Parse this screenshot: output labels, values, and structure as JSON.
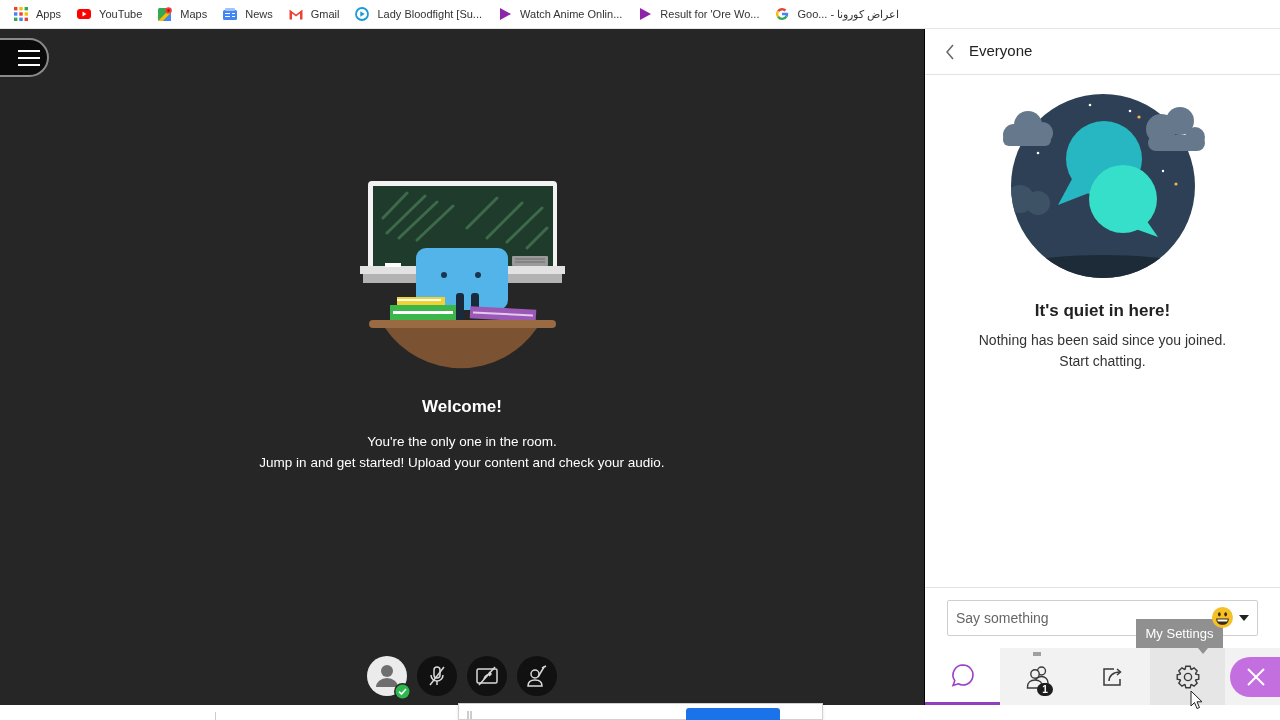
{
  "bookmarks_bar": {
    "items": [
      {
        "label": "Apps",
        "kind": "grid"
      },
      {
        "label": "YouTube",
        "kind": "video"
      },
      {
        "label": "Maps",
        "kind": "map"
      },
      {
        "label": "News",
        "kind": "news"
      },
      {
        "label": "Gmail",
        "kind": "mail"
      },
      {
        "label": "Lady Bloodfight [Su...",
        "kind": "circle-play"
      },
      {
        "label": "Watch Anime Onlin...",
        "kind": "play"
      },
      {
        "label": "Result for 'Ore Wo...",
        "kind": "play"
      },
      {
        "label": "Goo... - اعراض كورونا",
        "kind": "g-logo"
      }
    ]
  },
  "stage": {
    "welcome": {
      "title": "Welcome!",
      "lines": [
        "You're the only one in the room.",
        "Jump in and get started! Upload your content and check your audio."
      ]
    },
    "controls": [
      {
        "kind": "avatar",
        "status_ok": true
      },
      {
        "kind": "microphone",
        "on": false
      },
      {
        "kind": "camera",
        "on": false
      },
      {
        "kind": "hand"
      }
    ]
  },
  "chat_panel": {
    "header": {
      "title": "Everyone"
    },
    "empty_state": {
      "title": "It's quiet in here!",
      "text": "Nothing has been said since you joined. Start chatting."
    },
    "message_field": {
      "placeholder": "Say something"
    },
    "tooltip": {
      "text": "My Settings"
    },
    "tabs": [
      {
        "kind": "chat",
        "selected": true,
        "hovered": false
      },
      {
        "kind": "attendees",
        "selected": false,
        "hovered": false,
        "badge": "1"
      },
      {
        "kind": "share",
        "selected": false,
        "hovered": false
      },
      {
        "kind": "settings",
        "selected": false,
        "hovered": true
      }
    ]
  }
}
